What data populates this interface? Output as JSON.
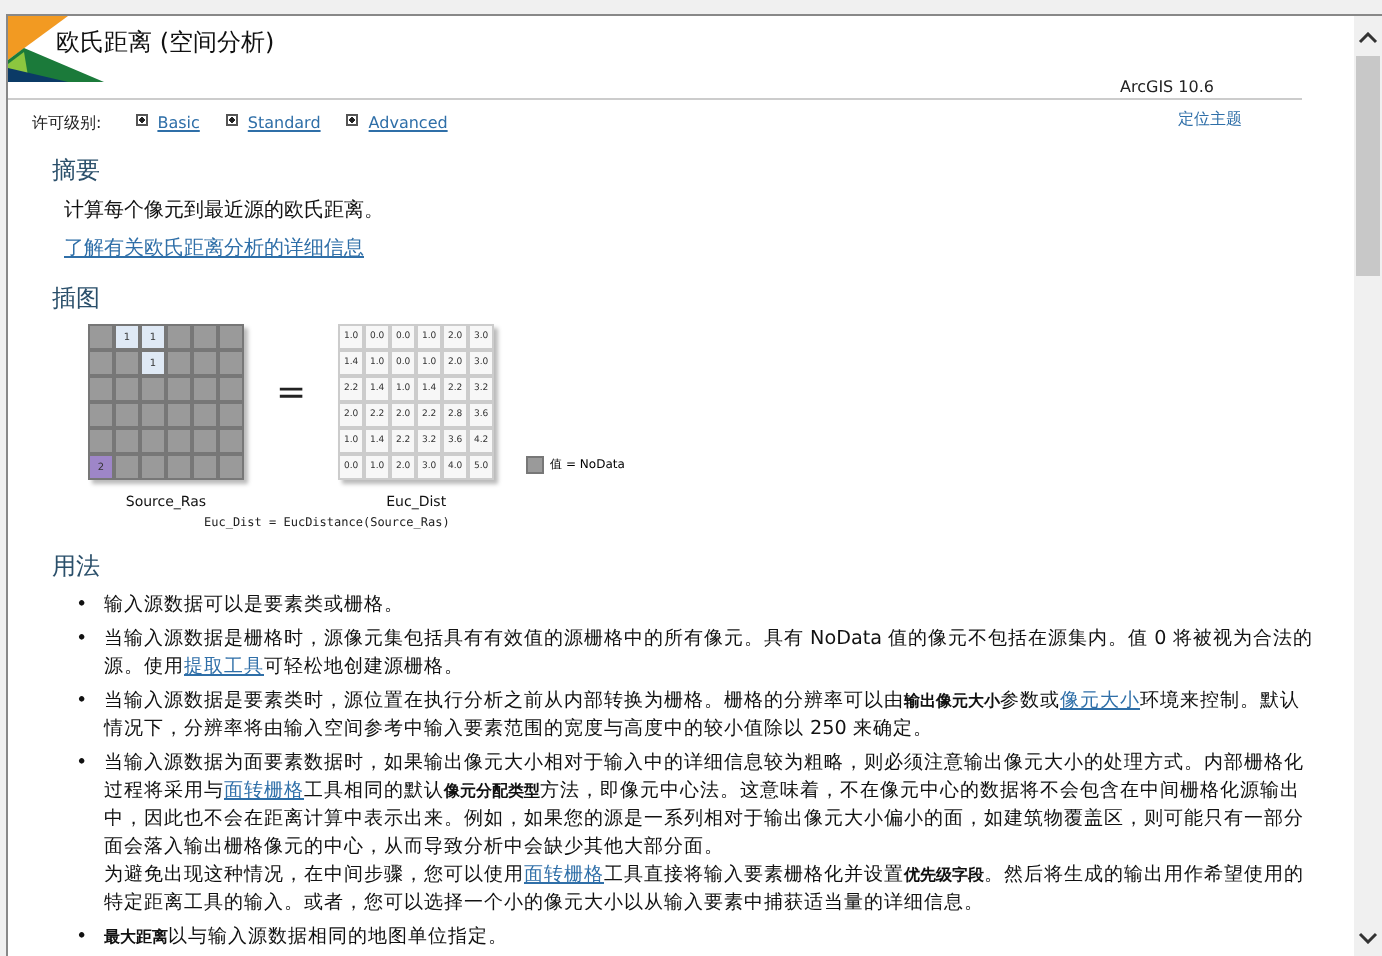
{
  "header": {
    "title": "欧氏距离 (空间分析)",
    "version": "ArcGIS 10.6"
  },
  "license": {
    "label": "许可级别:",
    "levels": [
      {
        "label": "Basic",
        "checked": true
      },
      {
        "label": "Standard",
        "checked": true
      },
      {
        "label": "Advanced",
        "checked": true
      }
    ],
    "locate": "定位主题"
  },
  "summary": {
    "heading": "摘要",
    "text": "计算每个像元到最近源的欧氏距离。",
    "link": "了解有关欧氏距离分析的详细信息"
  },
  "illustration": {
    "heading": "插图",
    "source": {
      "caption": "Source_Ras",
      "rows": [
        [
          {
            "kind": "nodata"
          },
          {
            "v": "1",
            "kind": "source"
          },
          {
            "v": "1",
            "kind": "source"
          },
          {
            "kind": "nodata"
          },
          {
            "kind": "nodata"
          },
          {
            "kind": "nodata"
          }
        ],
        [
          {
            "kind": "nodata"
          },
          {
            "kind": "nodata"
          },
          {
            "v": "1",
            "kind": "source"
          },
          {
            "kind": "nodata"
          },
          {
            "kind": "nodata"
          },
          {
            "kind": "nodata"
          }
        ],
        [
          {
            "kind": "nodata"
          },
          {
            "kind": "nodata"
          },
          {
            "kind": "nodata"
          },
          {
            "kind": "nodata"
          },
          {
            "kind": "nodata"
          },
          {
            "kind": "nodata"
          }
        ],
        [
          {
            "kind": "nodata"
          },
          {
            "kind": "nodata"
          },
          {
            "kind": "nodata"
          },
          {
            "kind": "nodata"
          },
          {
            "kind": "nodata"
          },
          {
            "kind": "nodata"
          }
        ],
        [
          {
            "kind": "nodata"
          },
          {
            "kind": "nodata"
          },
          {
            "kind": "nodata"
          },
          {
            "kind": "nodata"
          },
          {
            "kind": "nodata"
          },
          {
            "kind": "nodata"
          }
        ],
        [
          {
            "v": "2",
            "kind": "source2"
          },
          {
            "kind": "nodata"
          },
          {
            "kind": "nodata"
          },
          {
            "kind": "nodata"
          },
          {
            "kind": "nodata"
          },
          {
            "kind": "nodata"
          }
        ]
      ]
    },
    "operator": "=",
    "result": {
      "caption": "Euc_Dist",
      "rows": [
        [
          "1.0",
          "0.0",
          "0.0",
          "1.0",
          "2.0",
          "3.0"
        ],
        [
          "1.4",
          "1.0",
          "0.0",
          "1.0",
          "2.0",
          "3.0"
        ],
        [
          "2.2",
          "1.4",
          "1.0",
          "1.4",
          "2.2",
          "3.2"
        ],
        [
          "2.0",
          "2.2",
          "2.0",
          "2.2",
          "2.8",
          "3.6"
        ],
        [
          "1.0",
          "1.4",
          "2.2",
          "3.2",
          "3.6",
          "4.2"
        ],
        [
          "0.0",
          "1.0",
          "2.0",
          "3.0",
          "4.0",
          "5.0"
        ]
      ]
    },
    "legend": "值 = NoData",
    "formula": "Euc_Dist = EucDistance(Source_Ras)"
  },
  "usage": {
    "heading": "用法",
    "items": [
      {
        "bullet": "•",
        "paras": [
          [
            {
              "kind": "text",
              "t": "输入源数据可以是要素类或栅格。"
            }
          ]
        ]
      },
      {
        "bullet": "•",
        "paras": [
          [
            {
              "kind": "text",
              "t": "当输入源数据是栅格时，源像元集包括具有有效值的源栅格中的所有像元。具有 NoData 值的像元不包括在源集内。值 0 将被视为合法的源。使用"
            },
            {
              "kind": "link",
              "t": "提取工具"
            },
            {
              "kind": "text",
              "t": "可轻松地创建源栅格。"
            }
          ]
        ]
      },
      {
        "bullet": "•",
        "paras": [
          [
            {
              "kind": "text",
              "t": "当输入源数据是要素类时，源位置在执行分析之前从内部转换为栅格。栅格的分辨率可以由"
            },
            {
              "kind": "bold",
              "t": "输出像元大小"
            },
            {
              "kind": "text",
              "t": "参数或"
            },
            {
              "kind": "link",
              "t": "像元大小"
            },
            {
              "kind": "text",
              "t": "环境来控制。默认情况下，分辨率将由输入空间参考中输入要素范围的宽度与高度中的较小值除以 250 来确定。"
            }
          ]
        ]
      },
      {
        "bullet": "•",
        "paras": [
          [
            {
              "kind": "text",
              "t": "当输入源数据为面要素数据时，如果输出像元大小相对于输入中的详细信息较为粗略，则必须注意输出像元大小的处理方式。内部栅格化过程将采用与"
            },
            {
              "kind": "link",
              "t": "面转栅格"
            },
            {
              "kind": "text",
              "t": "工具相同的默认"
            },
            {
              "kind": "bold",
              "t": "像元分配类型"
            },
            {
              "kind": "text",
              "t": "方法，即像元中心法。这意味着，不在像元中心的数据将不会包含在中间栅格化源输出中，因此也不会在距离计算中表示出来。例如，如果您的源是一系列相对于输出像元大小偏小的面，如建筑物覆盖区，则可能只有一部分面会落入输出栅格像元的中心，从而导致分析中会缺少其他大部分面。"
            }
          ],
          [
            {
              "kind": "text",
              "t": "为避免出现这种情况，在中间步骤，您可以使用"
            },
            {
              "kind": "link",
              "t": "面转栅格"
            },
            {
              "kind": "text",
              "t": "工具直接将输入要素栅格化并设置"
            },
            {
              "kind": "bold",
              "t": "优先级字段"
            },
            {
              "kind": "text",
              "t": "。然后将生成的输出用作希望使用的特定距离工具的输入。或者，您可以选择一个小的像元大小以从输入要素中捕获适当量的详细信息。"
            }
          ]
        ]
      },
      {
        "bullet": "•",
        "paras": [
          [
            {
              "kind": "bold",
              "t": "最大距离"
            },
            {
              "kind": "text",
              "t": "以与输入源数据相同的地图单位指定。"
            }
          ]
        ]
      }
    ]
  }
}
